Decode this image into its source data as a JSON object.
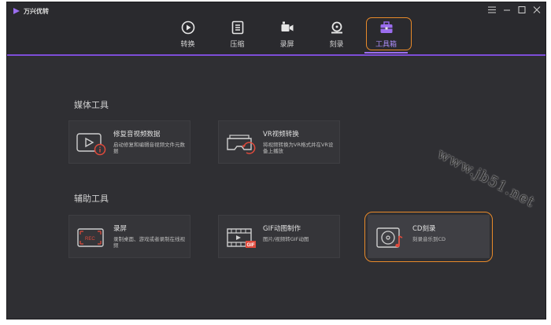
{
  "app": {
    "name": "万兴优转"
  },
  "window_controls": {
    "menu": "≡",
    "minimize": "—",
    "maximize": "☐",
    "close": "✕"
  },
  "nav": {
    "tabs": [
      {
        "label": "转换",
        "icon": "convert-icon"
      },
      {
        "label": "压缩",
        "icon": "compress-icon"
      },
      {
        "label": "录屏",
        "icon": "record-screen-icon"
      },
      {
        "label": "刻录",
        "icon": "burn-icon"
      },
      {
        "label": "工具箱",
        "icon": "toolbox-icon",
        "active": true
      }
    ]
  },
  "sections": {
    "media": {
      "title": "媒体工具",
      "cards": [
        {
          "title": "修复音视频数据",
          "desc": "启动修复和编辑音视频文件元数据",
          "icon": "fix-metadata-icon"
        },
        {
          "title": "VR视频转换",
          "desc": "将视频转换为VR格式并在VR设备上播放",
          "icon": "vr-convert-icon"
        }
      ]
    },
    "aux": {
      "title": "辅助工具",
      "cards": [
        {
          "title": "录屏",
          "desc": "录制桌面、游戏或者录制在线视频",
          "icon": "screen-recorder-icon",
          "rec_label": "REC"
        },
        {
          "title": "GIF动图制作",
          "desc": "图片/视频转GIF动图",
          "icon": "gif-maker-icon",
          "gif_label": "GIF"
        },
        {
          "title": "CD刻录",
          "desc": "刻录音乐到CD",
          "icon": "cd-burn-icon",
          "active": true
        }
      ]
    }
  },
  "watermark": "www.jb51.net",
  "colors": {
    "accent": "#9b6df0",
    "annotation": "#e88a2a",
    "red": "#e04a3c",
    "bg": "#2f2f33"
  }
}
